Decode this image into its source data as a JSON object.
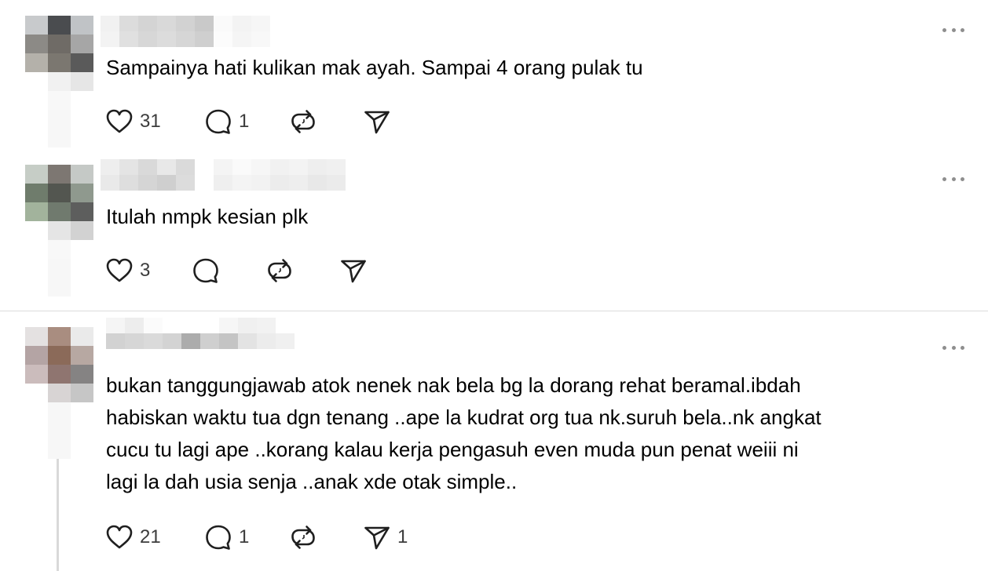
{
  "posts": [
    {
      "username": "",
      "text": "Sampainya hati kulikan mak ayah. Sampai 4 orang pulak tu",
      "likes": "31",
      "replies": "1",
      "reposts": "",
      "shares": ""
    },
    {
      "username": "",
      "text": "Itulah nmpk kesian plk",
      "likes": "3",
      "replies": "",
      "reposts": "",
      "shares": ""
    },
    {
      "username": "",
      "text": "bukan tanggungjawab atok nenek nak bela bg la dorang rehat beramal.ibdah\nhabiskan waktu tua dgn tenang ..ape la kudrat org tua nk.suruh bela..nk angkat\ncucu tu lagi ape ..korang kalau kerja pengasuh even muda pun penat weiii ni\nlagi la dah usia senja ..anak xde otak simple..",
      "likes": "21",
      "replies": "1",
      "reposts": "",
      "shares": "1"
    }
  ],
  "icons": {
    "like": "heart-icon",
    "reply": "speech-bubble-icon",
    "repost": "repost-arrows-icon",
    "share": "paper-plane-icon",
    "more": "more-options-icon"
  },
  "colors": {
    "text": "#000000",
    "icon": "#1f1f1f",
    "muted": "#8e8e8e",
    "divider": "#dcdcdc"
  }
}
